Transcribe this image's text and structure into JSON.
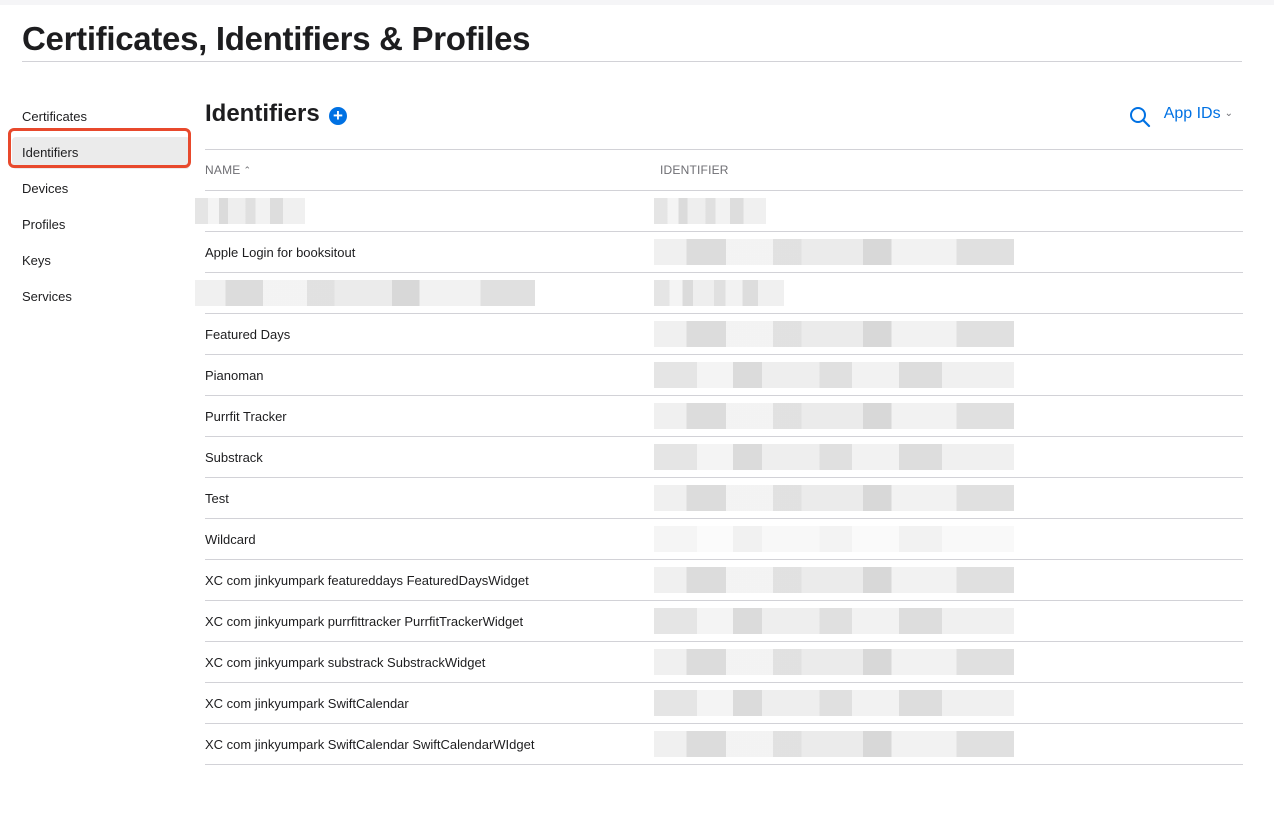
{
  "header": {
    "title": "Certificates, Identifiers & Profiles"
  },
  "sidebar": {
    "items": [
      {
        "label": "Certificates"
      },
      {
        "label": "Identifiers",
        "active": true
      },
      {
        "label": "Devices"
      },
      {
        "label": "Profiles"
      },
      {
        "label": "Keys"
      },
      {
        "label": "Services"
      }
    ]
  },
  "main": {
    "section_title": "Identifiers",
    "add_icon": "plus-circle-icon",
    "search_icon": "search-icon",
    "filter_label": "App IDs",
    "columns": {
      "name": "NAME",
      "identifier": "IDENTIFIER"
    },
    "rows": [
      {
        "name": ""
      },
      {
        "name": "Apple Login for booksitout"
      },
      {
        "name": ""
      },
      {
        "name": "Featured Days"
      },
      {
        "name": "Pianoman"
      },
      {
        "name": "Purrfit Tracker"
      },
      {
        "name": "Substrack"
      },
      {
        "name": "Test"
      },
      {
        "name": "Wildcard"
      },
      {
        "name": "XC com jinkyumpark featureddays FeaturedDaysWidget"
      },
      {
        "name": "XC com jinkyumpark purrfittracker PurrfitTrackerWidget"
      },
      {
        "name": "XC com jinkyumpark substrack SubstrackWidget"
      },
      {
        "name": "XC com jinkyumpark SwiftCalendar"
      },
      {
        "name": "XC com jinkyumpark SwiftCalendar SwiftCalendarWIdget"
      }
    ]
  },
  "colors": {
    "accent": "#0071e3",
    "highlight": "#e8492c",
    "divider": "#d2d2d7"
  }
}
